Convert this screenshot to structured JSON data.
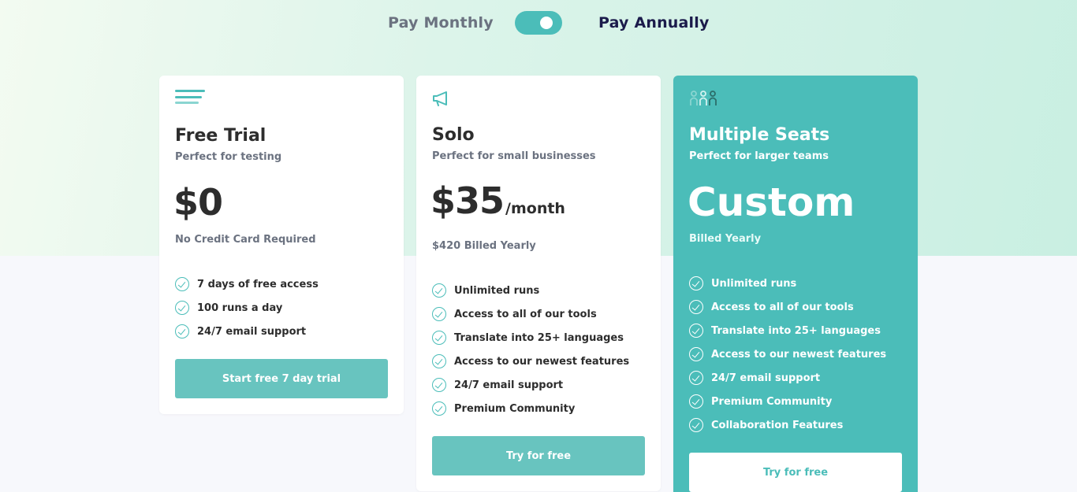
{
  "billing_toggle": {
    "monthly_label": "Pay Monthly",
    "annually_label": "Pay Annually",
    "selected": "annually"
  },
  "colors": {
    "accent": "#4bbdb9",
    "button": "#68c4bf",
    "heading": "#2d2d2d",
    "muted": "#6b7280"
  },
  "plans": [
    {
      "icon": "menu-lines-icon",
      "title": "Free Trial",
      "subtitle": "Perfect for testing",
      "price": "$0",
      "price_unit": "",
      "price_note": "No Credit Card Required",
      "features": [
        "7 days of free access",
        "100 runs a day",
        "24/7 email support"
      ],
      "cta": "Start free 7 day trial"
    },
    {
      "icon": "megaphone-icon",
      "title": "Solo",
      "subtitle": "Perfect for small businesses",
      "price": "$35",
      "price_unit": "/month",
      "price_note": "$420 Billed Yearly",
      "features": [
        "Unlimited runs",
        "Access to all of our tools",
        "Translate into 25+ languages",
        "Access to our newest features",
        "24/7 email support",
        "Premium Community"
      ],
      "cta": "Try for free"
    },
    {
      "icon": "people-group-icon",
      "title": "Multiple Seats",
      "subtitle": "Perfect for larger teams",
      "price": "Custom",
      "price_unit": "",
      "price_note": "Billed Yearly",
      "features": [
        "Unlimited runs",
        "Access to all of our tools",
        "Translate into 25+ languages",
        "Access to our newest features",
        "24/7 email support",
        "Premium Community",
        "Collaboration Features"
      ],
      "cta": "Try for free"
    }
  ]
}
